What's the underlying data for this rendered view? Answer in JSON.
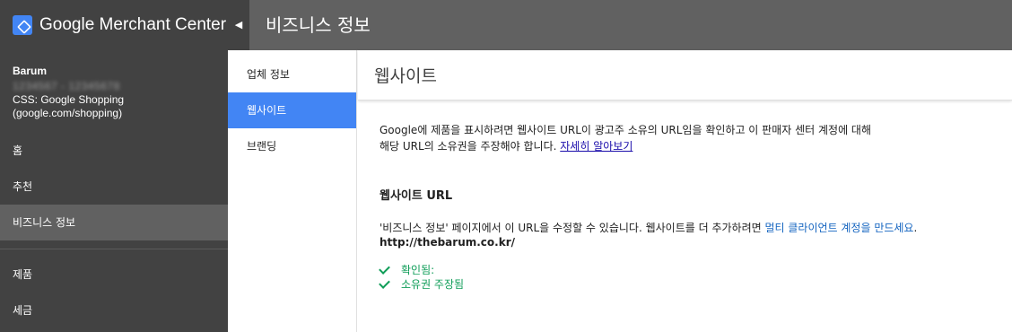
{
  "app": {
    "name": "Google Merchant Center"
  },
  "header": {
    "title": "비즈니스 정보"
  },
  "account": {
    "name": "Barum",
    "id_redacted": "1234567 - 12345678",
    "css_line1": "CSS: Google Shopping",
    "css_line2": "(google.com/shopping)"
  },
  "leftnav": {
    "items": [
      {
        "label": "홈"
      },
      {
        "label": "추천"
      },
      {
        "label": "비즈니스 정보"
      },
      {
        "label": "제품"
      },
      {
        "label": "세금"
      }
    ]
  },
  "subnav": {
    "items": [
      {
        "label": "업체 정보"
      },
      {
        "label": "웹사이트"
      },
      {
        "label": "브랜딩"
      }
    ]
  },
  "main": {
    "title": "웹사이트",
    "desc_line1": "Google에 제품을 표시하려면 웹사이트 URL이 광고주 소유의 URL임을 확인하고 이 판매자 센터 계정에 대해",
    "desc_line2": "해당 URL의 소유권을 주장해야 합니다. ",
    "learn_more": "자세히 알아보기",
    "section_title": "웹사이트 URL",
    "note_text": "'비즈니스 정보' 페이지에서 이 URL을 수정할 수 있습니다. 웹사이트를 더 추가하려면 ",
    "note_link": "멀티 클라이언트 계정을 만드세요",
    "note_end": ".",
    "url": "http://thebarum.co.kr/",
    "status": [
      {
        "label": "확인됨:"
      },
      {
        "label": "소유권 주장됨"
      }
    ]
  },
  "colors": {
    "topbar": "#616161",
    "nav_bg": "#424242",
    "accent": "#4285f4",
    "success": "#0f9d58",
    "link": "#1a0dab"
  }
}
